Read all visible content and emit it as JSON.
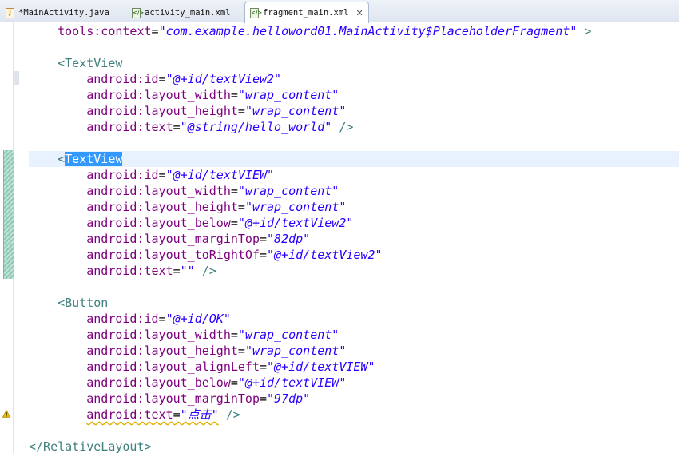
{
  "tabs": [
    {
      "label": "*MainActivity.java",
      "icon": "java-file-icon",
      "active": false
    },
    {
      "label": "activity_main.xml",
      "icon": "xml-file-icon",
      "active": false
    },
    {
      "label": "fragment_main.xml",
      "icon": "xml-file-icon",
      "active": true
    }
  ],
  "code": {
    "l1": {
      "attr": "tools:context",
      "value": "\"com.example.helloword01.MainActivity$PlaceholderFragment\"",
      "tail": " >"
    },
    "l3": {
      "tag": "<TextView"
    },
    "l4": {
      "attr": "android:id",
      "value": "\"@+id/textView2\""
    },
    "l5": {
      "attr": "android:layout_width",
      "value": "\"wrap_content\""
    },
    "l6": {
      "attr": "android:layout_height",
      "value": "\"wrap_content\""
    },
    "l7": {
      "attr": "android:text",
      "value": "\"@string/hello_world\"",
      "tail": " />"
    },
    "l9": {
      "lt": "<",
      "tag": "TextView"
    },
    "l10": {
      "attr": "android:id",
      "value": "\"@+id/textVIEW\""
    },
    "l11": {
      "attr": "android:layout_width",
      "value": "\"wrap_content\""
    },
    "l12": {
      "attr": "android:layout_height",
      "value": "\"wrap_content\""
    },
    "l13": {
      "attr": "android:layout_below",
      "value": "\"@+id/textView2\""
    },
    "l14": {
      "attr": "android:layout_marginTop",
      "value": "\"82dp\""
    },
    "l15": {
      "attr": "android:layout_toRightOf",
      "value": "\"@+id/textView2\""
    },
    "l16": {
      "attr": "android:text",
      "value": "\"\"",
      "tail": " />"
    },
    "l18": {
      "tag": "<Button"
    },
    "l19": {
      "attr": "android:id",
      "value": "\"@+id/OK\""
    },
    "l20": {
      "attr": "android:layout_width",
      "value": "\"wrap_content\""
    },
    "l21": {
      "attr": "android:layout_height",
      "value": "\"wrap_content\""
    },
    "l22": {
      "attr": "android:layout_alignLeft",
      "value": "\"@+id/textVIEW\""
    },
    "l23": {
      "attr": "android:layout_below",
      "value": "\"@+id/textVIEW\""
    },
    "l24": {
      "attr": "android:layout_marginTop",
      "value": "\"97dp\""
    },
    "l25": {
      "attr": "android:text",
      "value": "\"点击\"",
      "tail": " />"
    },
    "l27": {
      "tag": "</RelativeLayout>"
    }
  },
  "colors": {
    "tag": "#3f7f7f",
    "attribute": "#7f007f",
    "value": "#2a00ff",
    "selection": "#3399ff",
    "current_line": "#e8f2fe"
  }
}
